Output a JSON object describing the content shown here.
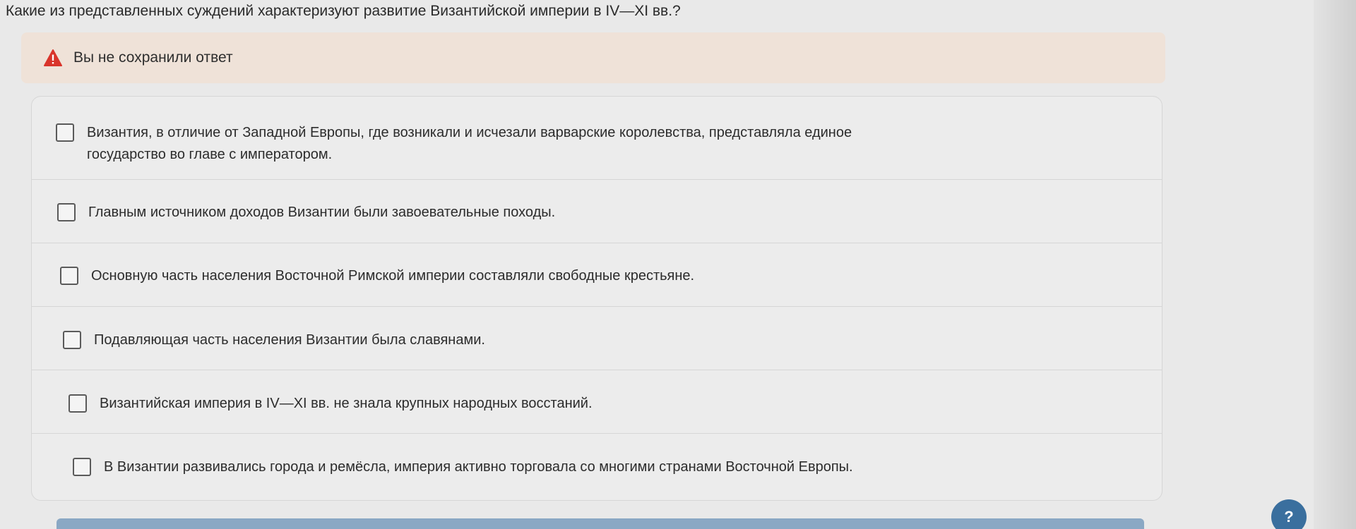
{
  "question": {
    "text": "Какие из представленных суждений характеризуют развитие Византийской империи в IV—XI вв.?"
  },
  "alert": {
    "icon": "warning-icon",
    "accent_color": "#d9342b",
    "text": "Вы не сохранили ответ"
  },
  "options": [
    {
      "text": "Византия, в отличие от Западной Европы, где возникали и исчезали варварские королевства, представляла единое государство во главе с императором.",
      "checked": false
    },
    {
      "text": "Главным источником доходов Византии были завоевательные походы.",
      "checked": false
    },
    {
      "text": "Основную часть населения Восточной Римской империи составляли свободные крестьяне.",
      "checked": false
    },
    {
      "text": "Подавляющая часть населения Византии была славянами.",
      "checked": false
    },
    {
      "text": "Византийская империя в IV—XI вв. не знала крупных народных восстаний.",
      "checked": false
    },
    {
      "text": "В Византии развивались города и ремёсла, империя активно торговала со многими странами Восточной Европы.",
      "checked": false
    }
  ],
  "help": {
    "label": "?",
    "color": "#3a6f9e"
  }
}
